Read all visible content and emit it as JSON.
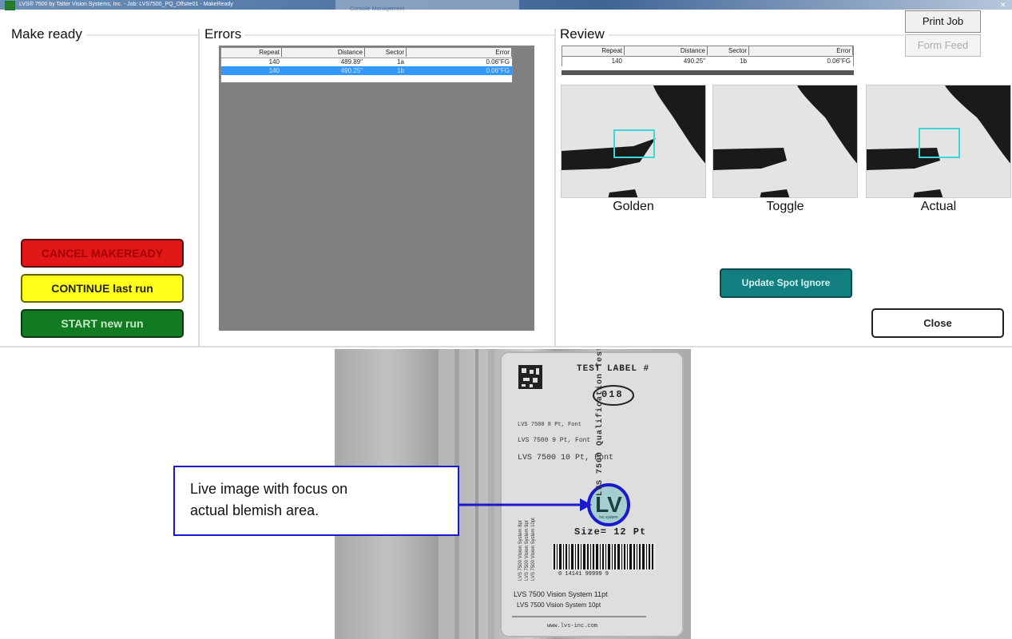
{
  "window": {
    "title": "LVS® 7500 by Tatter Vision Systems, Inc. - Job: LVS7500_PQ_Offsite01 - MakeReady",
    "second_window_title": "Console Management"
  },
  "make_ready": {
    "title": "Make ready",
    "buttons": {
      "cancel": "CANCEL MAKEREADY",
      "continue": "CONTINUE last run",
      "start": "START new run"
    },
    "colors": {
      "cancel": "#e21818",
      "continue": "#ffff1a",
      "start": "#127a20"
    }
  },
  "errors": {
    "title": "Errors",
    "columns": [
      "Repeat",
      "Distance",
      "Sector",
      "Error"
    ],
    "rows": [
      {
        "repeat": "140",
        "distance": "489.89\"",
        "sector": "1a",
        "error": "0.06\"FG"
      },
      {
        "repeat": "140",
        "distance": "490.25\"",
        "sector": "1b",
        "error": "0.06\"FG"
      }
    ],
    "selected_row": 1
  },
  "review": {
    "title": "Review",
    "columns": [
      "Repeat",
      "Distance",
      "Sector",
      "Error"
    ],
    "row": {
      "repeat": "140",
      "distance": "490.25\"",
      "sector": "1b",
      "error": "0.06\"FG"
    },
    "thumbnails": [
      "Golden",
      "Toggle",
      "Actual"
    ],
    "update_spot_ignore": "Update Spot Ignore",
    "close": "Close",
    "accent": "#137e80"
  },
  "toolbar": {
    "print_job": "Print Job",
    "form_feed": "Form Feed"
  },
  "live_image": {
    "label": {
      "header": "TEST LABEL #",
      "number": "018",
      "font_lines": [
        "LVS 7500 8 Pt, Font",
        "LVS 7500 9 Pt, Font",
        "LVS 7500 10 Pt, Font"
      ],
      "size": "Size= 12 Pt",
      "vertical": "LVS 7500 Qualification Test",
      "side_small_1": "LVS 7500 Vision System 8pt",
      "side_small_2": "LVS 7500 Vision System 9pt",
      "side_small_3": "LVS 7500 Vision System 10pt",
      "barcode_digits": "0 14141 99999 9",
      "bottom_1": "LVS 7500 Vision System 11pt",
      "bottom_2": "LVS 7500 Vision System 10pt",
      "url": "www.lvs-inc.com",
      "logo": "LV",
      "logo_sub": "lvs system"
    }
  },
  "callout": {
    "text_line1": "Live image with focus on",
    "text_line2": "actual blemish area.",
    "color": "#1a1acc"
  }
}
